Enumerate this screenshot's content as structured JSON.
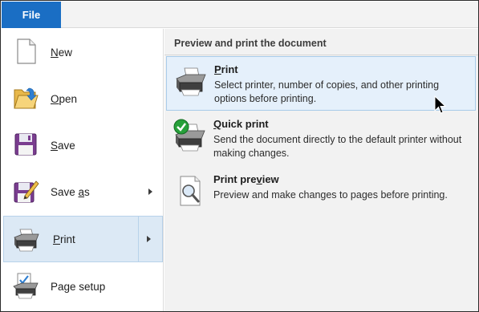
{
  "file_tab": {
    "label": "File"
  },
  "left_menu": {
    "items": [
      {
        "label": "New",
        "mnemonic": "N",
        "rest": "ew"
      },
      {
        "label": "Open",
        "mnemonic": "O",
        "rest": "pen"
      },
      {
        "label": "Save",
        "mnemonic": "S",
        "rest": "ave"
      },
      {
        "pre": "Save ",
        "mnemonic": "a",
        "rest": "s"
      },
      {
        "label": "Print",
        "mnemonic": "P",
        "rest": "rint"
      },
      {
        "pre": "Pa",
        "mnemonic": "g",
        "rest": "e setup"
      }
    ]
  },
  "right_pane": {
    "section_title": "Preview and print the document",
    "options": [
      {
        "title_mnemonic": "P",
        "title_rest": "rint",
        "desc": "Select printer, number of copies, and other printing options before printing."
      },
      {
        "title_mnemonic": "Q",
        "title_rest": "uick print",
        "desc": "Send the document directly to the default printer without making changes."
      },
      {
        "title_pre": "Print pre",
        "title_mnemonic": "v",
        "title_rest": "iew",
        "desc": "Preview and make changes to pages before printing."
      }
    ]
  },
  "colors": {
    "file_tab": "#1a6ec4",
    "selected_bg": "#dce9f5",
    "hover_bg": "#e5f0fb"
  },
  "icons": {
    "new": "new-document-icon",
    "open": "open-folder-icon",
    "save": "floppy-disk-icon",
    "save_as": "save-as-icon",
    "print": "printer-icon",
    "page_setup": "page-setup-icon",
    "quick_print": "quick-print-icon",
    "print_preview": "print-preview-icon"
  }
}
